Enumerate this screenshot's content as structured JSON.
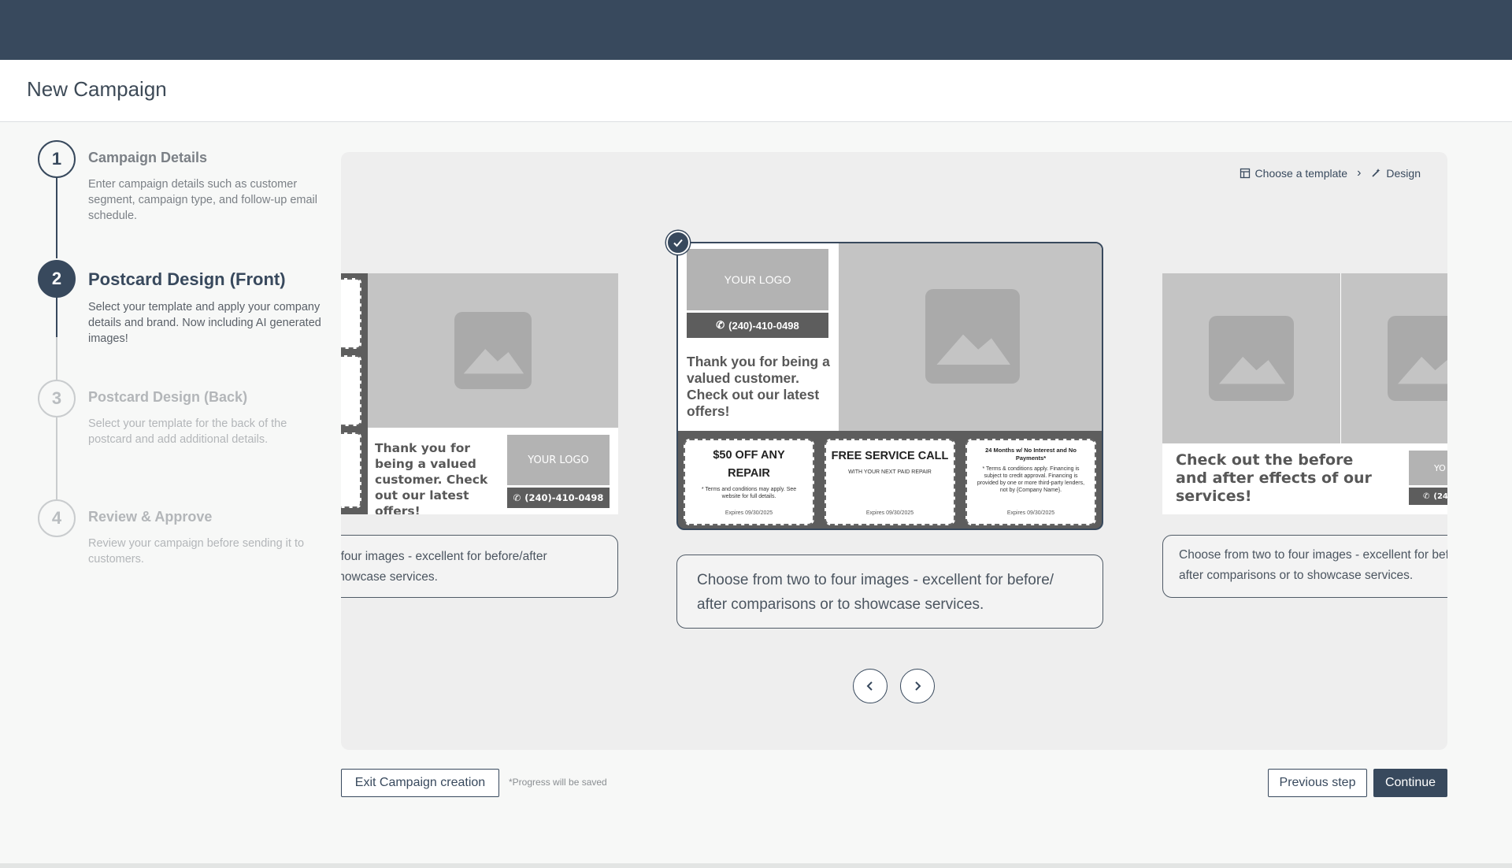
{
  "app": {
    "page_title": "New Campaign"
  },
  "steps": [
    {
      "number": "1",
      "title": "Campaign Details",
      "description": "Enter campaign details such as customer segment, campaign type, and follow-up email schedule."
    },
    {
      "number": "2",
      "title": "Postcard Design (Front)",
      "description": "Select your template and apply your company details and brand. Now including AI generated images!"
    },
    {
      "number": "3",
      "title": "Postcard Design (Back)",
      "description": "Select your template for the back of the postcard  and add additional details."
    },
    {
      "number": "4",
      "title": "Review & Approve",
      "description": "Review your campaign before sending it to customers."
    }
  ],
  "breadcrumb": {
    "template_label": "Choose a template",
    "design_label": "Design"
  },
  "templates": {
    "left": {
      "thanks": "Thank you for being a valued customer. Check out our latest offers!",
      "logo": "YOUR LOGO",
      "phone": "(240)-410-0498",
      "description": "Choose from two to four images  - excellent for before/after comparisons or to showcase services."
    },
    "center": {
      "logo": "YOUR LOGO",
      "phone": "(240)-410-0498",
      "thanks": "Thank you for being a valued customer. Check out our latest offers!",
      "coupons": [
        {
          "headline": "$50 OFF ANY REPAIR",
          "fine_print": "* Terms and conditions may apply. See website for full details.",
          "expires": "Expires 09/30/2025"
        },
        {
          "headline": "FREE SERVICE CALL",
          "fine_print": "WITH YOUR NEXT PAID REPAIR",
          "expires": "Expires 09/30/2025"
        },
        {
          "headline": "24 Months w/ No Interest and No Payments*",
          "fine_print": "* Terms & conditions apply. Financing is subject to credit approval. Financing is provided by one or more third-party lenders, not by {Company Name}.",
          "expires": "Expires 09/30/2025"
        }
      ],
      "description": "Choose from two to four images  - excellent for before/ after comparisons or to showcase services."
    },
    "right": {
      "headline": "Check out the before and after effects of our services!",
      "logo_partial": "YO",
      "phone_partial": "(24",
      "description": "Choose from two to four images  - excellent for before/ after comparisons or to showcase services."
    }
  },
  "carousel": {
    "prev_icon": "chevron-left-icon",
    "next_icon": "chevron-right-icon",
    "selected_icon": "check-icon"
  },
  "footer": {
    "exit_label": "Exit Campaign creation",
    "progress_note": "*Progress will be saved",
    "previous_label": "Previous step",
    "continue_label": "Continue"
  },
  "colors": {
    "brand": "#38495d",
    "panel": "#eeeeee",
    "placeholder": "#c4c4c4"
  }
}
